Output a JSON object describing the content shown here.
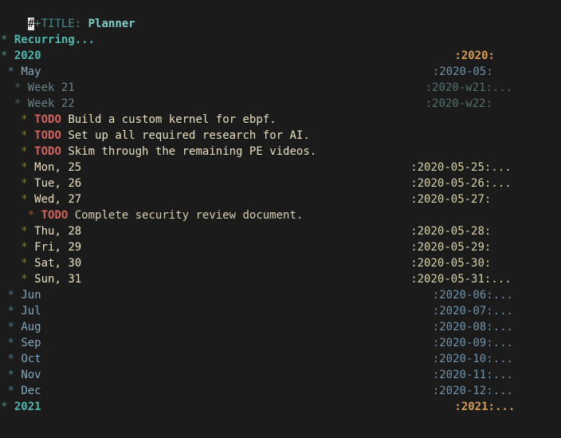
{
  "buffer": {
    "mode": "org-mode",
    "background": "#1b1b1b",
    "title_keyword": "#+TITLE:",
    "title_value": "Planner",
    "cursor_char": "#",
    "title_keyword_rest": "+TITLE:"
  },
  "colors": {
    "background": "#1b1b1b",
    "level1": "#4fb8ae",
    "level2": "#7fa7bd",
    "level3": "#6e8287",
    "level4": "#e8dfc0",
    "level5": "#d8cfb4",
    "todo": "#d4635e",
    "tag_year": "#d79b53",
    "tag_month": "#6f93a8",
    "tag_week": "#54706f",
    "tag_day": "#d9d2a8",
    "cursor": "#e8e8e8"
  },
  "outline": [
    {
      "id": "recurring",
      "level": 1,
      "stars": "*",
      "indent": 0,
      "text": "Recurring...",
      "todo": "",
      "tag": "",
      "tag_ellipsis": "",
      "tag_kind": ""
    },
    {
      "id": "year-2020",
      "level": 1,
      "stars": "*",
      "indent": 0,
      "text": "2020",
      "todo": "",
      "tag": ":2020:",
      "tag_ellipsis": "",
      "tag_kind": "year"
    },
    {
      "id": "month-may",
      "level": 2,
      "stars": "*",
      "indent": 1,
      "text": "May",
      "todo": "",
      "tag": ":2020-05:",
      "tag_ellipsis": "",
      "tag_kind": "month"
    },
    {
      "id": "week-21",
      "level": 3,
      "stars": "*",
      "indent": 2,
      "text": "Week 21",
      "todo": "",
      "tag": ":2020-w21:",
      "tag_ellipsis": "...",
      "tag_kind": "week"
    },
    {
      "id": "week-22",
      "level": 3,
      "stars": "*",
      "indent": 2,
      "text": "Week 22",
      "todo": "",
      "tag": ":2020-w22:",
      "tag_ellipsis": "",
      "tag_kind": "week"
    },
    {
      "id": "todo-kernel",
      "level": 4,
      "stars": "*",
      "indent": 3,
      "text": "Build a custom kernel for ebpf.",
      "todo": "TODO",
      "tag": "",
      "tag_ellipsis": "",
      "tag_kind": ""
    },
    {
      "id": "todo-research-ai",
      "level": 4,
      "stars": "*",
      "indent": 3,
      "text": "Set up all required research for AI.",
      "todo": "TODO",
      "tag": "",
      "tag_ellipsis": "",
      "tag_kind": ""
    },
    {
      "id": "todo-pe-videos",
      "level": 4,
      "stars": "*",
      "indent": 3,
      "text": "Skim through the remaining PE videos.",
      "todo": "TODO",
      "tag": "",
      "tag_ellipsis": "",
      "tag_kind": ""
    },
    {
      "id": "day-mon-25",
      "level": 4,
      "stars": "*",
      "indent": 3,
      "text": "Mon, 25",
      "todo": "",
      "tag": ":2020-05-25:",
      "tag_ellipsis": "...",
      "tag_kind": "day"
    },
    {
      "id": "day-tue-26",
      "level": 4,
      "stars": "*",
      "indent": 3,
      "text": "Tue, 26",
      "todo": "",
      "tag": ":2020-05-26:",
      "tag_ellipsis": "...",
      "tag_kind": "day"
    },
    {
      "id": "day-wed-27",
      "level": 4,
      "stars": "*",
      "indent": 3,
      "text": "Wed, 27",
      "todo": "",
      "tag": ":2020-05-27:",
      "tag_ellipsis": "",
      "tag_kind": "day"
    },
    {
      "id": "todo-security-review",
      "level": 5,
      "stars": "*",
      "indent": 4,
      "text": "Complete security review document.",
      "todo": "TODO",
      "tag": "",
      "tag_ellipsis": "",
      "tag_kind": ""
    },
    {
      "id": "day-thu-28",
      "level": 4,
      "stars": "*",
      "indent": 3,
      "text": "Thu, 28",
      "todo": "",
      "tag": ":2020-05-28:",
      "tag_ellipsis": "",
      "tag_kind": "day"
    },
    {
      "id": "day-fri-29",
      "level": 4,
      "stars": "*",
      "indent": 3,
      "text": "Fri, 29",
      "todo": "",
      "tag": ":2020-05-29:",
      "tag_ellipsis": "",
      "tag_kind": "day"
    },
    {
      "id": "day-sat-30",
      "level": 4,
      "stars": "*",
      "indent": 3,
      "text": "Sat, 30",
      "todo": "",
      "tag": ":2020-05-30:",
      "tag_ellipsis": "",
      "tag_kind": "day"
    },
    {
      "id": "day-sun-31",
      "level": 4,
      "stars": "*",
      "indent": 3,
      "text": "Sun, 31",
      "todo": "",
      "tag": ":2020-05-31:",
      "tag_ellipsis": "...",
      "tag_kind": "day"
    },
    {
      "id": "month-jun",
      "level": 2,
      "stars": "*",
      "indent": 1,
      "text": "Jun",
      "todo": "",
      "tag": ":2020-06:",
      "tag_ellipsis": "...",
      "tag_kind": "month"
    },
    {
      "id": "month-jul",
      "level": 2,
      "stars": "*",
      "indent": 1,
      "text": "Jul",
      "todo": "",
      "tag": ":2020-07:",
      "tag_ellipsis": "...",
      "tag_kind": "month"
    },
    {
      "id": "month-aug",
      "level": 2,
      "stars": "*",
      "indent": 1,
      "text": "Aug",
      "todo": "",
      "tag": ":2020-08:",
      "tag_ellipsis": "...",
      "tag_kind": "month"
    },
    {
      "id": "month-sep",
      "level": 2,
      "stars": "*",
      "indent": 1,
      "text": "Sep",
      "todo": "",
      "tag": ":2020-09:",
      "tag_ellipsis": "...",
      "tag_kind": "month"
    },
    {
      "id": "month-oct",
      "level": 2,
      "stars": "*",
      "indent": 1,
      "text": "Oct",
      "todo": "",
      "tag": ":2020-10:",
      "tag_ellipsis": "...",
      "tag_kind": "month"
    },
    {
      "id": "month-nov",
      "level": 2,
      "stars": "*",
      "indent": 1,
      "text": "Nov",
      "todo": "",
      "tag": ":2020-11:",
      "tag_ellipsis": "...",
      "tag_kind": "month"
    },
    {
      "id": "month-dec",
      "level": 2,
      "stars": "*",
      "indent": 1,
      "text": "Dec",
      "todo": "",
      "tag": ":2020-12:",
      "tag_ellipsis": "...",
      "tag_kind": "month"
    },
    {
      "id": "year-2021",
      "level": 1,
      "stars": "*",
      "indent": 0,
      "text": "2021",
      "todo": "",
      "tag": ":2021:",
      "tag_ellipsis": "...",
      "tag_kind": "year"
    }
  ]
}
